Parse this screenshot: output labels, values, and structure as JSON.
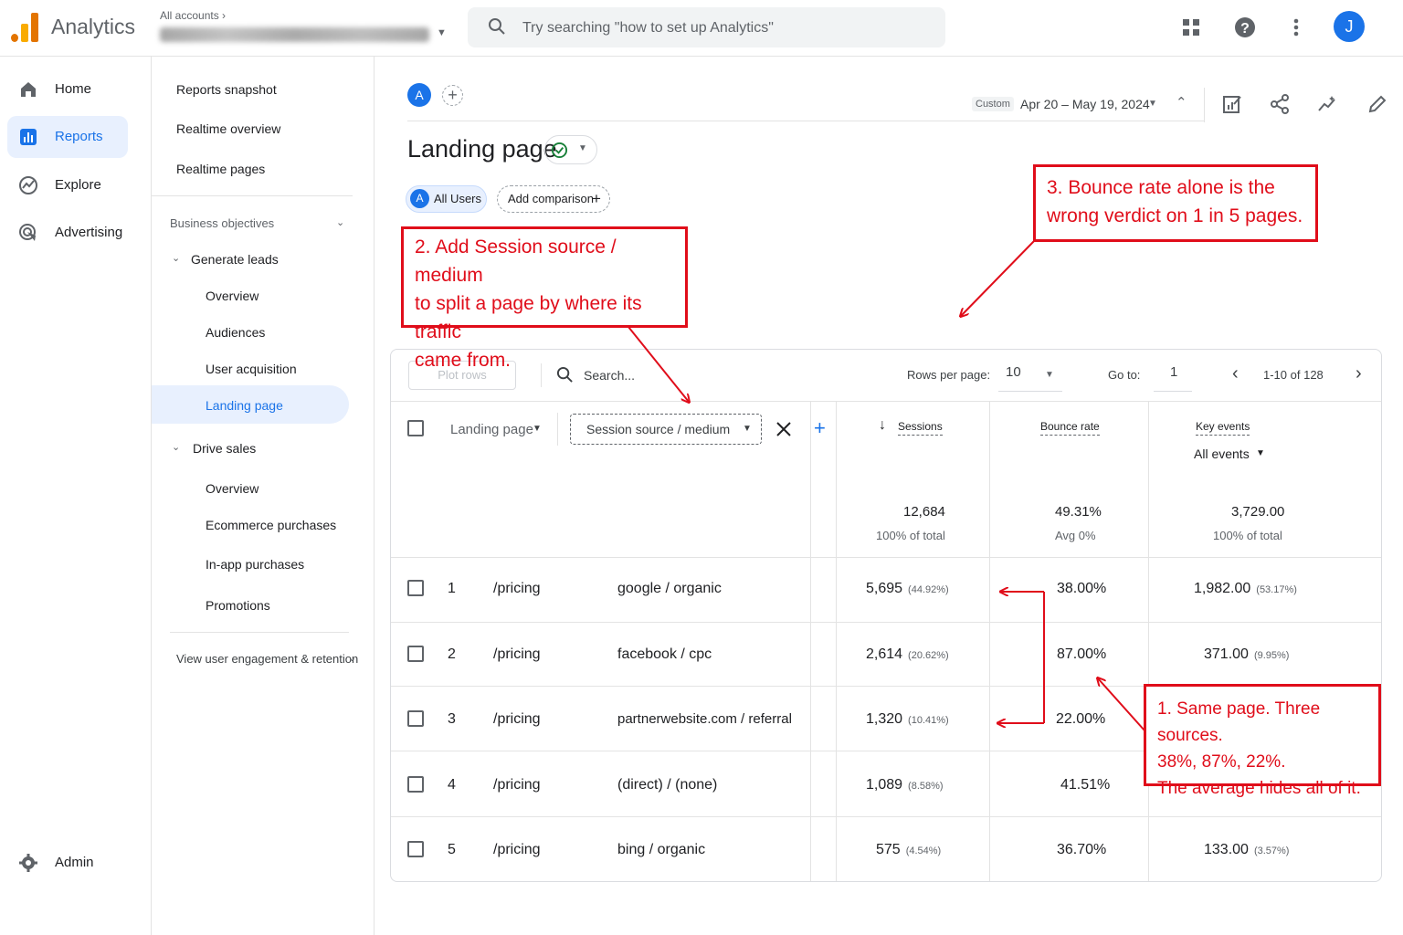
{
  "app": {
    "name": "Analytics"
  },
  "account": {
    "label": "All accounts",
    "chevron": "›"
  },
  "search": {
    "placeholder": "Try searching \"how to set up Analytics\""
  },
  "user": {
    "initial": "J"
  },
  "nav": {
    "home": "Home",
    "reports": "Reports",
    "explore": "Explore",
    "advertising": "Advertising",
    "admin": "Admin"
  },
  "subnav": {
    "snapshot": "Reports snapshot",
    "realtime_overview": "Realtime overview",
    "realtime_pages": "Realtime pages",
    "business_objectives": "Business objectives",
    "generate_leads": "Generate leads",
    "leads_overview": "Overview",
    "audiences": "Audiences",
    "user_acquisition": "User acquisition",
    "landing_page": "Landing page",
    "drive_sales": "Drive sales",
    "sales_overview": "Overview",
    "ecommerce": "Ecommerce purchases",
    "in_app": "In-app purchases",
    "promotions": "Promotions",
    "engagement": "View user engagement & retention"
  },
  "header": {
    "segment_initial": "A",
    "date_tag": "Custom",
    "date_range": "Apr 20 – May 19, 2024",
    "title": "Landing page"
  },
  "chips": {
    "all_users": "All Users",
    "add_comparison": "Add comparison"
  },
  "table": {
    "plot_rows": "Plot rows",
    "search": "Search...",
    "rows_per_page_label": "Rows per page:",
    "rows_per_page": "10",
    "goto_label": "Go to:",
    "goto_value": "1",
    "pagination": "1-10 of 128",
    "dim1": "Landing page",
    "dim2": "Session source / medium",
    "col_sessions": "Sessions",
    "col_bounce": "Bounce rate",
    "col_key": "Key events",
    "key_filter": "All events",
    "totals": {
      "sessions": "12,684",
      "sessions_sub": "100% of total",
      "bounce": "49.31%",
      "bounce_sub": "Avg 0%",
      "key": "3,729.00",
      "key_sub": "100% of total"
    },
    "rows": [
      {
        "n": "1",
        "page": "/pricing",
        "source": "google / organic",
        "sessions": "5,695",
        "sessions_pct": "(44.92%)",
        "bounce": "38.00%",
        "key": "1,982.00",
        "key_pct": "(53.17%)"
      },
      {
        "n": "2",
        "page": "/pricing",
        "source": "facebook / cpc",
        "sessions": "2,614",
        "sessions_pct": "(20.62%)",
        "bounce": "87.00%",
        "key": "371.00",
        "key_pct": "(9.95%)"
      },
      {
        "n": "3",
        "page": "/pricing",
        "source": "partnerwebsite.com / referral",
        "sessions": "1,320",
        "sessions_pct": "(10.41%)",
        "bounce": "22.00%",
        "key": "",
        "key_pct": ""
      },
      {
        "n": "4",
        "page": "/pricing",
        "source": "(direct) / (none)",
        "sessions": "1,089",
        "sessions_pct": "(8.58%)",
        "bounce": "41.51%",
        "key": "",
        "key_pct": ""
      },
      {
        "n": "5",
        "page": "/pricing",
        "source": "bing / organic",
        "sessions": "575",
        "sessions_pct": "(4.54%)",
        "bounce": "36.70%",
        "key": "133.00",
        "key_pct": "(3.57%)"
      }
    ]
  },
  "annotations": {
    "a1": [
      "1. Same page. Three sources.",
      "38%, 87%, 22%.",
      "The average hides all of it."
    ],
    "a2": [
      "2. Add Session source / medium",
      "to split a page by where its traffic",
      "came from."
    ],
    "a3": [
      "3. Bounce rate alone is the",
      "wrong verdict on 1 in 5 pages."
    ]
  },
  "colors": {
    "accent": "#1a73e8",
    "annotation": "#e00d1a",
    "logo_orange": "#f9ab00",
    "logo_dark": "#e37400"
  }
}
